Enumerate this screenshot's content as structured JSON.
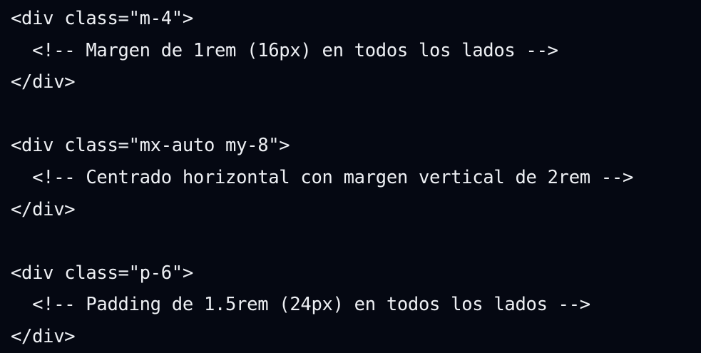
{
  "code": {
    "lines": [
      "<div class=\"m-4\">",
      "  <!-- Margen de 1rem (16px) en todos los lados -->",
      "</div>",
      "",
      "<div class=\"mx-auto my-8\">",
      "  <!-- Centrado horizontal con margen vertical de 2rem -->",
      "</div>",
      "",
      "<div class=\"p-6\">",
      "  <!-- Padding de 1.5rem (24px) en todos los lados -->",
      "</div>"
    ]
  },
  "colors": {
    "background": "#050812",
    "text": "#eef0f4"
  }
}
